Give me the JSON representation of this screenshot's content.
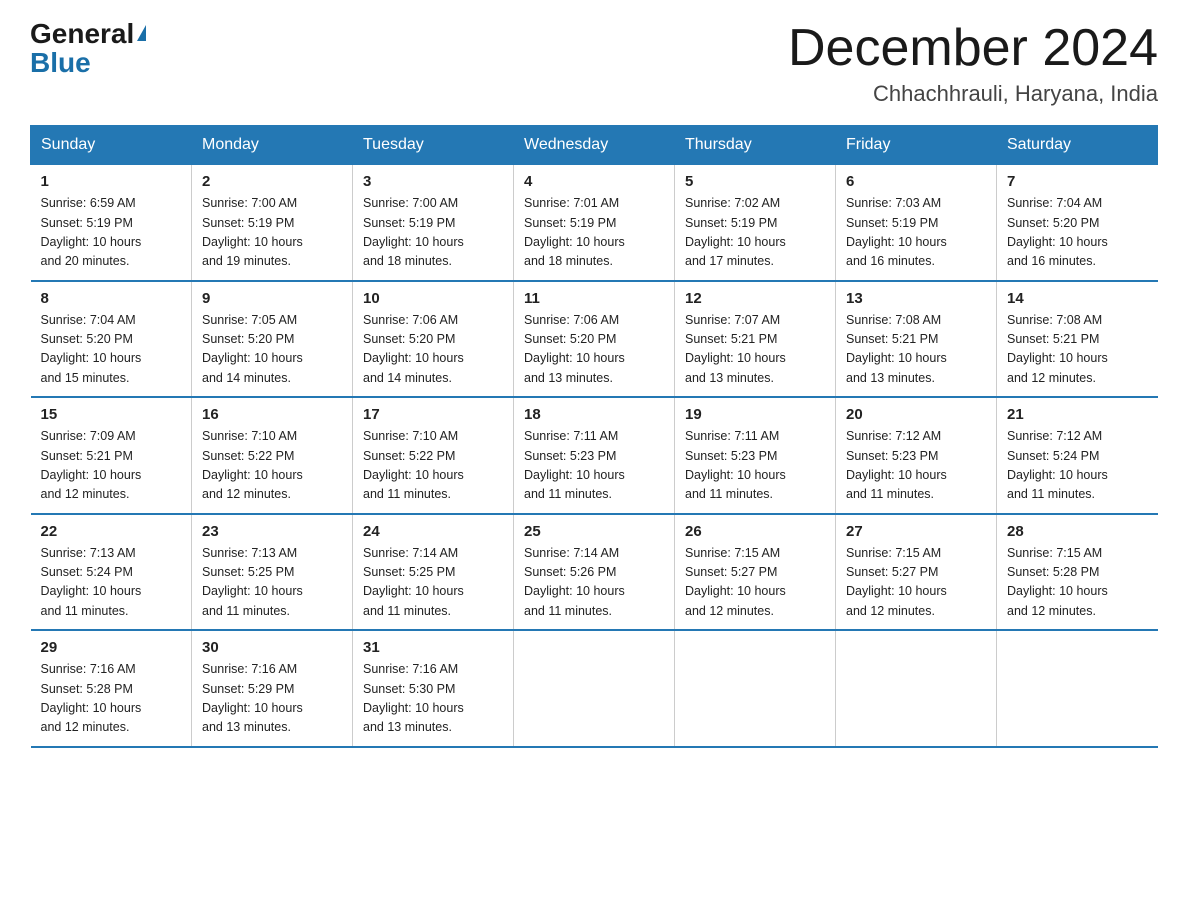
{
  "logo": {
    "part1": "General",
    "part2": "Blue"
  },
  "header": {
    "month_year": "December 2024",
    "location": "Chhachhrauli, Haryana, India"
  },
  "weekdays": [
    "Sunday",
    "Monday",
    "Tuesday",
    "Wednesday",
    "Thursday",
    "Friday",
    "Saturday"
  ],
  "weeks": [
    [
      {
        "day": "1",
        "sunrise": "6:59 AM",
        "sunset": "5:19 PM",
        "daylight": "10 hours and 20 minutes."
      },
      {
        "day": "2",
        "sunrise": "7:00 AM",
        "sunset": "5:19 PM",
        "daylight": "10 hours and 19 minutes."
      },
      {
        "day": "3",
        "sunrise": "7:00 AM",
        "sunset": "5:19 PM",
        "daylight": "10 hours and 18 minutes."
      },
      {
        "day": "4",
        "sunrise": "7:01 AM",
        "sunset": "5:19 PM",
        "daylight": "10 hours and 18 minutes."
      },
      {
        "day": "5",
        "sunrise": "7:02 AM",
        "sunset": "5:19 PM",
        "daylight": "10 hours and 17 minutes."
      },
      {
        "day": "6",
        "sunrise": "7:03 AM",
        "sunset": "5:19 PM",
        "daylight": "10 hours and 16 minutes."
      },
      {
        "day": "7",
        "sunrise": "7:04 AM",
        "sunset": "5:20 PM",
        "daylight": "10 hours and 16 minutes."
      }
    ],
    [
      {
        "day": "8",
        "sunrise": "7:04 AM",
        "sunset": "5:20 PM",
        "daylight": "10 hours and 15 minutes."
      },
      {
        "day": "9",
        "sunrise": "7:05 AM",
        "sunset": "5:20 PM",
        "daylight": "10 hours and 14 minutes."
      },
      {
        "day": "10",
        "sunrise": "7:06 AM",
        "sunset": "5:20 PM",
        "daylight": "10 hours and 14 minutes."
      },
      {
        "day": "11",
        "sunrise": "7:06 AM",
        "sunset": "5:20 PM",
        "daylight": "10 hours and 13 minutes."
      },
      {
        "day": "12",
        "sunrise": "7:07 AM",
        "sunset": "5:21 PM",
        "daylight": "10 hours and 13 minutes."
      },
      {
        "day": "13",
        "sunrise": "7:08 AM",
        "sunset": "5:21 PM",
        "daylight": "10 hours and 13 minutes."
      },
      {
        "day": "14",
        "sunrise": "7:08 AM",
        "sunset": "5:21 PM",
        "daylight": "10 hours and 12 minutes."
      }
    ],
    [
      {
        "day": "15",
        "sunrise": "7:09 AM",
        "sunset": "5:21 PM",
        "daylight": "10 hours and 12 minutes."
      },
      {
        "day": "16",
        "sunrise": "7:10 AM",
        "sunset": "5:22 PM",
        "daylight": "10 hours and 12 minutes."
      },
      {
        "day": "17",
        "sunrise": "7:10 AM",
        "sunset": "5:22 PM",
        "daylight": "10 hours and 11 minutes."
      },
      {
        "day": "18",
        "sunrise": "7:11 AM",
        "sunset": "5:23 PM",
        "daylight": "10 hours and 11 minutes."
      },
      {
        "day": "19",
        "sunrise": "7:11 AM",
        "sunset": "5:23 PM",
        "daylight": "10 hours and 11 minutes."
      },
      {
        "day": "20",
        "sunrise": "7:12 AM",
        "sunset": "5:23 PM",
        "daylight": "10 hours and 11 minutes."
      },
      {
        "day": "21",
        "sunrise": "7:12 AM",
        "sunset": "5:24 PM",
        "daylight": "10 hours and 11 minutes."
      }
    ],
    [
      {
        "day": "22",
        "sunrise": "7:13 AM",
        "sunset": "5:24 PM",
        "daylight": "10 hours and 11 minutes."
      },
      {
        "day": "23",
        "sunrise": "7:13 AM",
        "sunset": "5:25 PM",
        "daylight": "10 hours and 11 minutes."
      },
      {
        "day": "24",
        "sunrise": "7:14 AM",
        "sunset": "5:25 PM",
        "daylight": "10 hours and 11 minutes."
      },
      {
        "day": "25",
        "sunrise": "7:14 AM",
        "sunset": "5:26 PM",
        "daylight": "10 hours and 11 minutes."
      },
      {
        "day": "26",
        "sunrise": "7:15 AM",
        "sunset": "5:27 PM",
        "daylight": "10 hours and 12 minutes."
      },
      {
        "day": "27",
        "sunrise": "7:15 AM",
        "sunset": "5:27 PM",
        "daylight": "10 hours and 12 minutes."
      },
      {
        "day": "28",
        "sunrise": "7:15 AM",
        "sunset": "5:28 PM",
        "daylight": "10 hours and 12 minutes."
      }
    ],
    [
      {
        "day": "29",
        "sunrise": "7:16 AM",
        "sunset": "5:28 PM",
        "daylight": "10 hours and 12 minutes."
      },
      {
        "day": "30",
        "sunrise": "7:16 AM",
        "sunset": "5:29 PM",
        "daylight": "10 hours and 13 minutes."
      },
      {
        "day": "31",
        "sunrise": "7:16 AM",
        "sunset": "5:30 PM",
        "daylight": "10 hours and 13 minutes."
      },
      null,
      null,
      null,
      null
    ]
  ],
  "labels": {
    "sunrise": "Sunrise:",
    "sunset": "Sunset:",
    "daylight": "Daylight:"
  }
}
